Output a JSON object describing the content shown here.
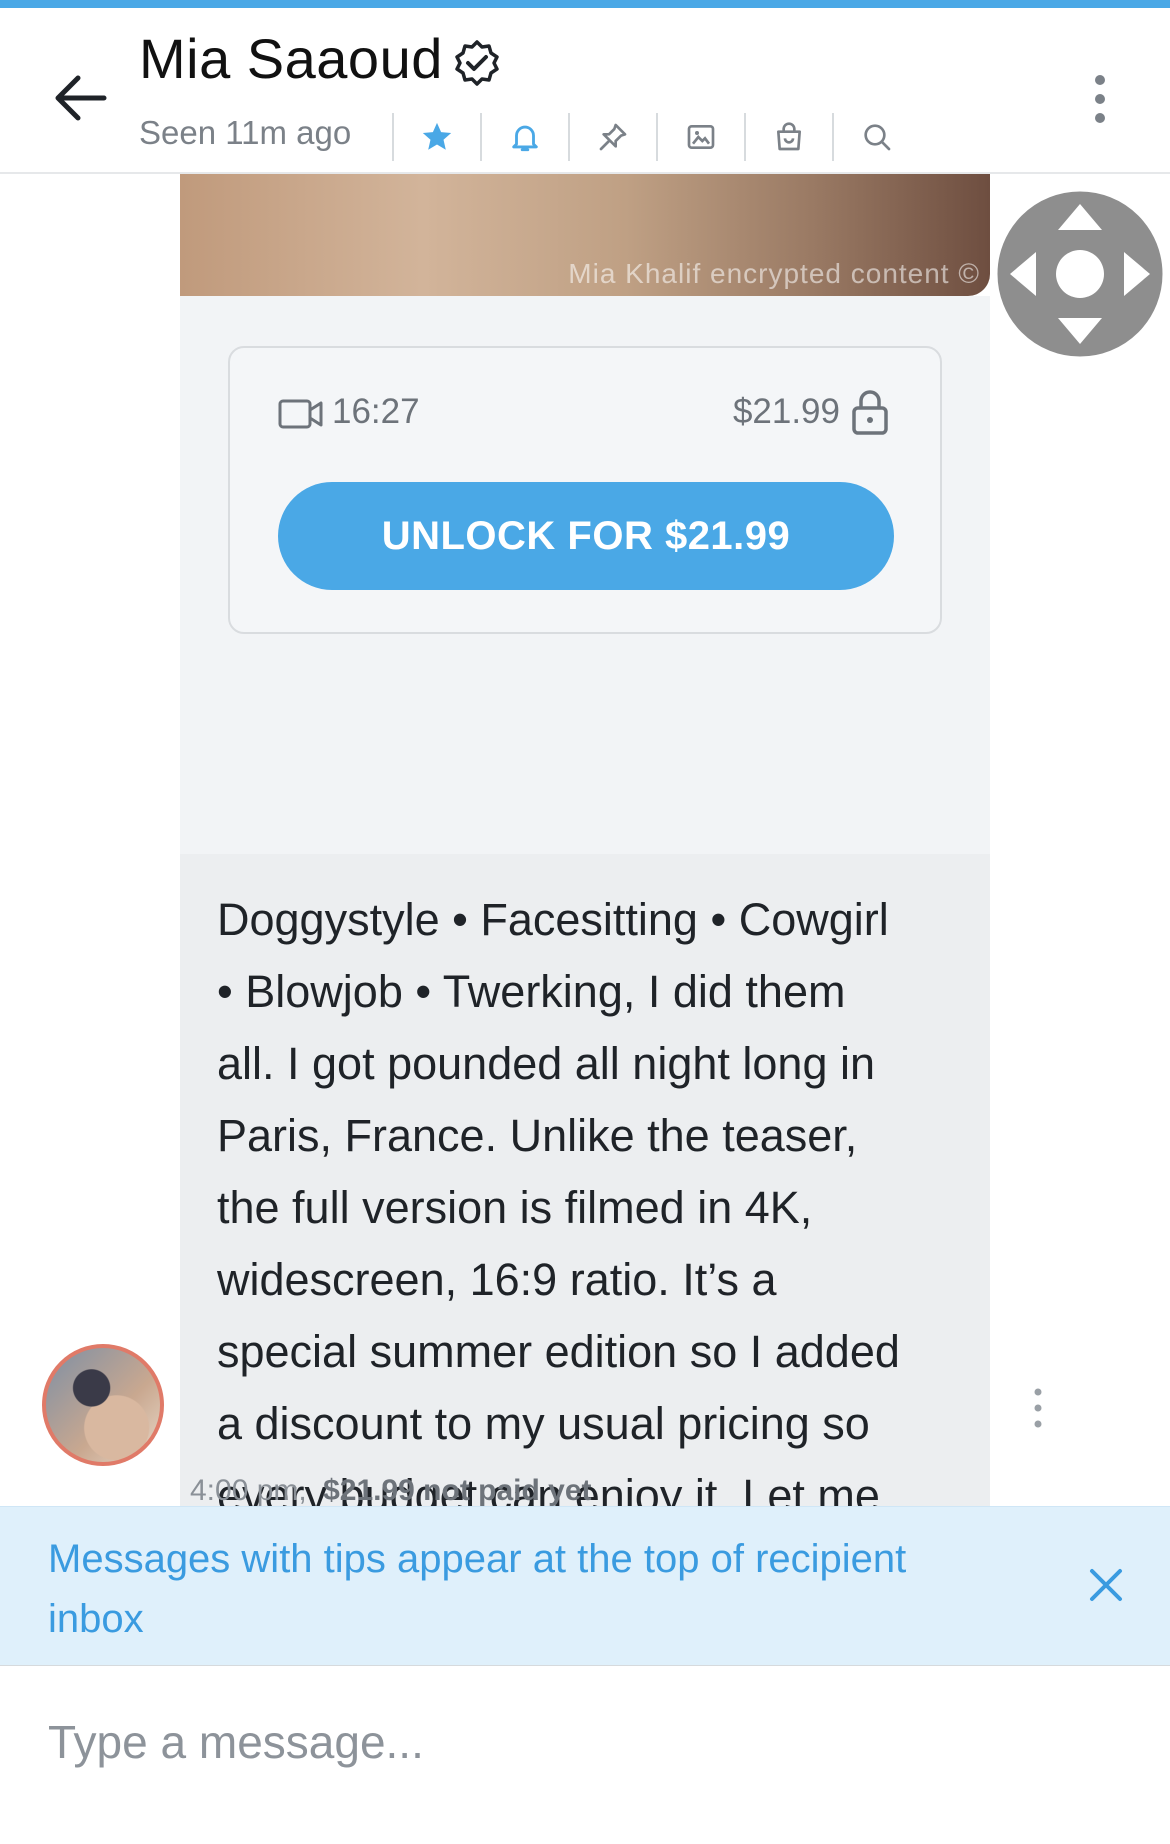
{
  "header": {
    "name": "Mia Saaoud",
    "status": "Seen 11m ago",
    "icons": [
      "star-icon",
      "bell-icon",
      "pin-icon",
      "image-icon",
      "shopping-bag-icon",
      "search-icon"
    ],
    "accent": "#4aa8e6"
  },
  "message": {
    "watermark": "Mia Khalif encrypted content ©",
    "duration": "16:27",
    "price": "$21.99",
    "unlock_label": "UNLOCK FOR $21.99",
    "text": "Doggystyle • Facesitting • Cowgirl\n• Blowjob • Twerking, I did them\nall. I got pounded all night long in\nParis, France. Unlike the teaser,\nthe full version is filmed in 4K,\nwidescreen, 16:9 ratio. It’s a\nspecial summer edition so I added\na discount to my usual pricing so\nevery budget can enjoy it. Let me\nknow if you like it! :)",
    "time": "4:00 pm,",
    "payment_status": "$21.99 not paid yet"
  },
  "banner": {
    "text": "Messages with tips appear at the top of recipient inbox"
  },
  "composer": {
    "placeholder": "Type a message..."
  }
}
